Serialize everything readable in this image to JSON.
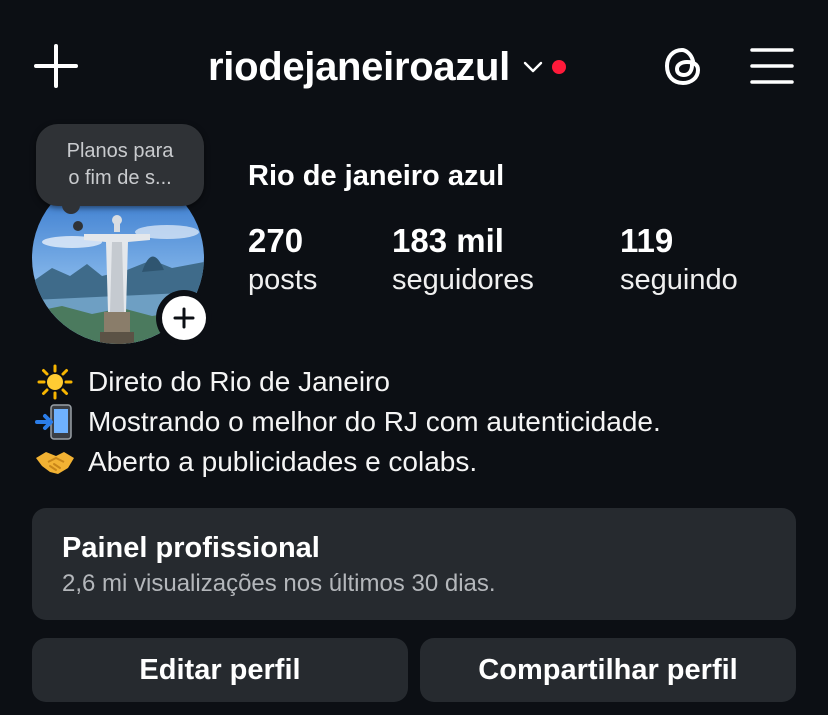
{
  "header": {
    "username": "riodejaneiroazul",
    "icons": {
      "create": "plus-icon",
      "account_switcher": "chevron-down-icon",
      "threads": "threads-icon",
      "menu": "hamburger-menu-icon"
    },
    "notification_dot_color": "#ff1a3a"
  },
  "profile": {
    "note": "Planos para\no fim de s...",
    "display_name": "Rio de janeiro azul",
    "avatar": "avatar-christ-the-redeemer",
    "stats": [
      {
        "value": "270",
        "label": "posts"
      },
      {
        "value": "183 mil",
        "label": "seguidores"
      },
      {
        "value": "119",
        "label": "seguindo"
      }
    ]
  },
  "bio": [
    {
      "icon": "sun-emoji",
      "text": "Direto do Rio de Janeiro"
    },
    {
      "icon": "mobile-phone-arrow-emoji",
      "text": "Mostrando o melhor do RJ com autenticidade."
    },
    {
      "icon": "handshake-emoji",
      "text": "Aberto a publicidades e colabs."
    }
  ],
  "professional_dashboard": {
    "title": "Painel profissional",
    "subtitle": "2,6 mi visualizações nos últimos 30 dias."
  },
  "actions": {
    "edit_profile": "Editar perfil",
    "share_profile": "Compartilhar perfil"
  },
  "colors": {
    "background": "#0c0f14",
    "card": "#262a2f",
    "note_bubble": "#2f3236"
  }
}
